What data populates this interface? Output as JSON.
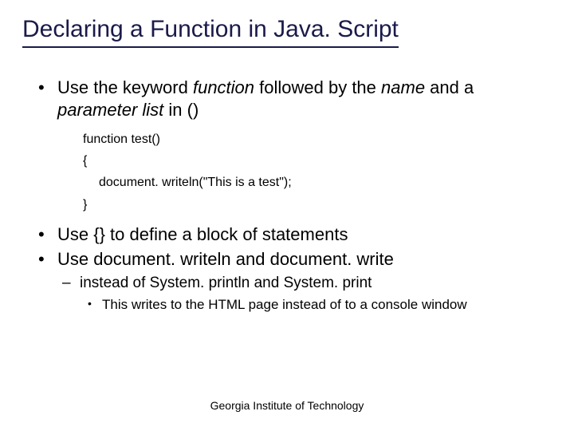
{
  "title": "Declaring a Function in Java. Script",
  "bullets": [
    {
      "prefix": "Use the keyword ",
      "em1": "function",
      "mid1": " followed by the ",
      "em2": "name",
      "mid2": " and a ",
      "em3": "parameter list",
      "suffix": " in ()"
    },
    {
      "text": "Use {} to define a block of statements"
    },
    {
      "text": "Use document. writeln and document. write"
    }
  ],
  "code": {
    "line1": "function test()",
    "line2": "{",
    "line3": "document. writeln(\"This is a test\");",
    "line4": "}"
  },
  "sub": {
    "text": "instead of System. println and System. print"
  },
  "subsub": {
    "text": "This writes to the HTML page instead of to a console window"
  },
  "footer": "Georgia Institute of Technology"
}
